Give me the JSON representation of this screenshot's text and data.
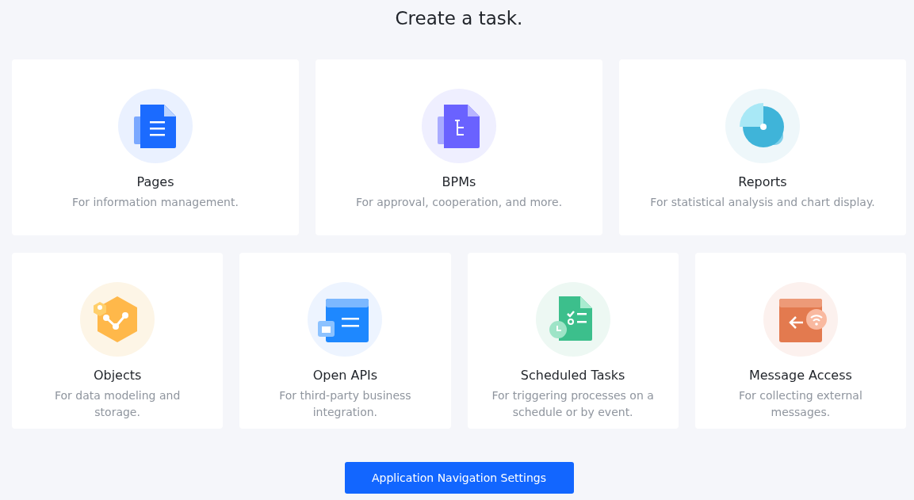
{
  "title": "Create a task.",
  "top_cards": [
    {
      "kind": "pages",
      "title": "Pages",
      "description": "For information management."
    },
    {
      "kind": "bpms",
      "title": "BPMs",
      "description": "For approval, cooperation, and more."
    },
    {
      "kind": "reports",
      "title": "Reports",
      "description": "For statistical analysis and chart display."
    }
  ],
  "bottom_cards": [
    {
      "kind": "objects",
      "title": "Objects",
      "description": "For data modeling and storage."
    },
    {
      "kind": "apis",
      "title": "Open APIs",
      "description": "For third-party business integration."
    },
    {
      "kind": "scheduled",
      "title": "Scheduled Tasks",
      "description": "For triggering processes on a schedule or by event."
    },
    {
      "kind": "message",
      "title": "Message Access",
      "description": "For collecting external messages."
    }
  ],
  "button": "Application Navigation Settings"
}
